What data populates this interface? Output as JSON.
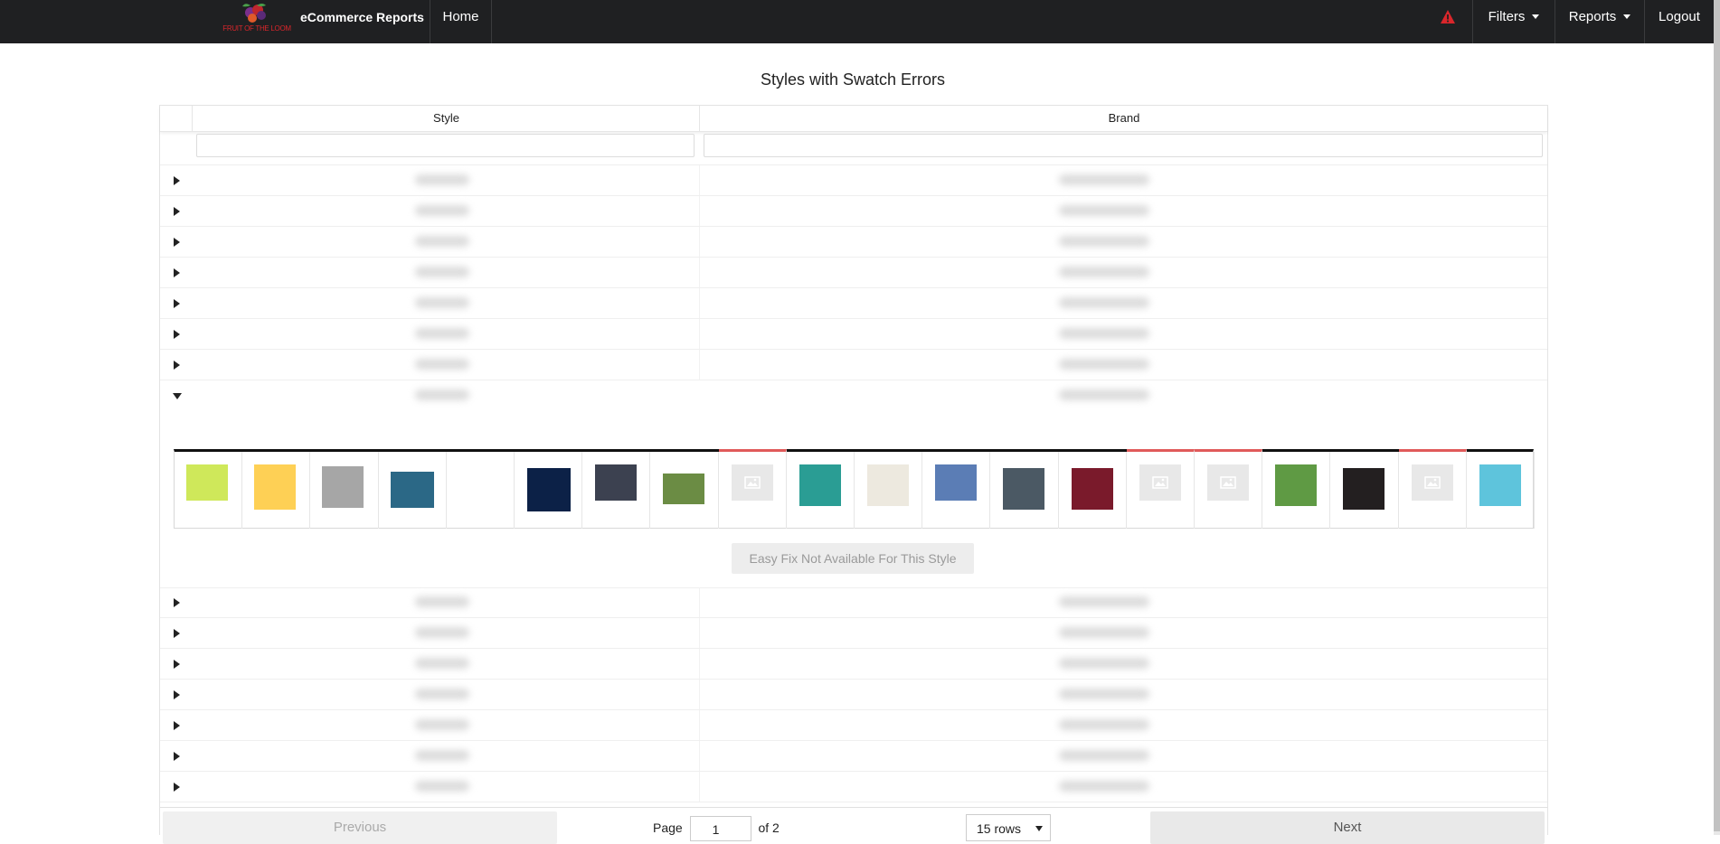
{
  "navbar": {
    "brand": "eCommerce Reports",
    "logo_text": "FRUIT OF THE LOOM",
    "home": "Home",
    "filters": "Filters",
    "reports": "Reports",
    "logout": "Logout"
  },
  "page": {
    "title": "Styles with Swatch Errors"
  },
  "table": {
    "columns": [
      "Style",
      "Brand"
    ],
    "rows_above": 7,
    "expanded_index": 7,
    "rows_below": 7
  },
  "swatches": [
    {
      "color": "#cfe85a"
    },
    {
      "color": "#fed055"
    },
    {
      "color": "#a6a6a6"
    },
    {
      "color": "#2b6886"
    },
    {
      "color": "#ffffff"
    },
    {
      "color": "#0c2147"
    },
    {
      "color": "#3c4150"
    },
    {
      "color": "#6b8c44"
    },
    {
      "color": null,
      "error": true
    },
    {
      "color": "#2a9d94"
    },
    {
      "color": "#ede9df"
    },
    {
      "color": "#5b7db5"
    },
    {
      "color": "#4b5964"
    },
    {
      "color": "#7a1a2b"
    },
    {
      "color": null,
      "error": true
    },
    {
      "color": null,
      "error": true
    },
    {
      "color": "#5f9a44"
    },
    {
      "color": "#231f20"
    },
    {
      "color": null,
      "error": true
    },
    {
      "color": "#5ec4dc"
    }
  ],
  "easy_fix": "Easy Fix Not Available For This Style",
  "pagination": {
    "previous": "Previous",
    "page_label": "Page",
    "current": "1",
    "of_label": "of 2",
    "rows_option": "15 rows",
    "next": "Next"
  }
}
